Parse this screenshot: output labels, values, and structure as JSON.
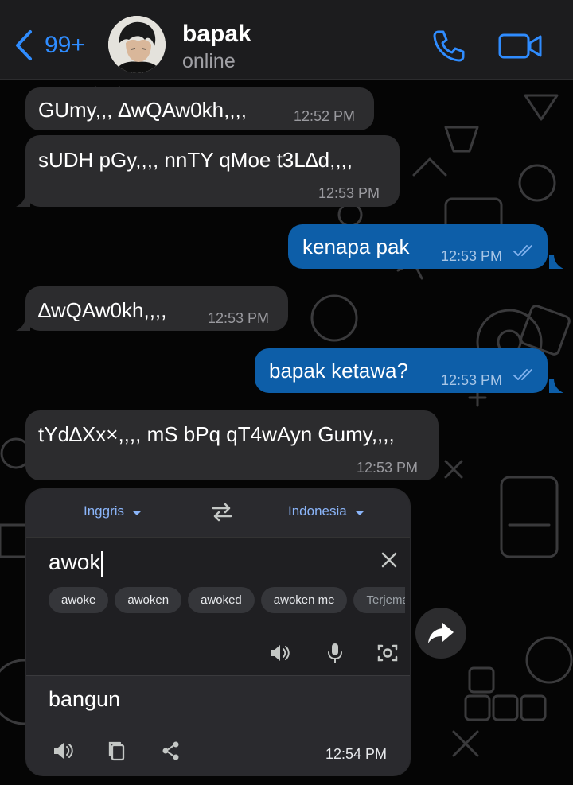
{
  "header": {
    "back_count": "99+",
    "contact_name": "bapak",
    "contact_status": "online",
    "accent": "#2f8cff"
  },
  "messages": [
    {
      "direction": "in",
      "text": "GUmy,,, ∆wQAw0kh,,,,",
      "time": "12:52 PM"
    },
    {
      "direction": "in",
      "text": "sUDH pGy,,,, nnTY qMoe t3L∆d,,,,",
      "time": "12:53 PM"
    },
    {
      "direction": "out",
      "text": "kenapa pak",
      "time": "12:53 PM",
      "status": "read"
    },
    {
      "direction": "in",
      "text": "∆wQAw0kh,,,,",
      "time": "12:53 PM"
    },
    {
      "direction": "out",
      "text": "bapak ketawa?",
      "time": "12:53 PM",
      "status": "read"
    },
    {
      "direction": "in",
      "text": "tYd∆Xx×,,,, mS bPq qT4wAyn Gumy,,,,",
      "time": "12:53 PM"
    }
  ],
  "translate": {
    "source_lang": "Inggris",
    "target_lang": "Indonesia",
    "input_text": "awok",
    "suggestions": [
      "awoke",
      "awoken",
      "awoked",
      "awoken me",
      "Terjemahkan d"
    ],
    "output_text": "bangun",
    "time": "12:54 PM",
    "icons": [
      "swap-icon",
      "clear-icon",
      "speaker-icon",
      "mic-icon",
      "camera-icon",
      "copy-icon",
      "share-icon"
    ]
  },
  "colors": {
    "incoming_bubble": "#2c2c2e",
    "outgoing_bubble": "#0d5ea8",
    "header_bg": "#1c1c1e",
    "link_blue": "#8ab4f8"
  }
}
